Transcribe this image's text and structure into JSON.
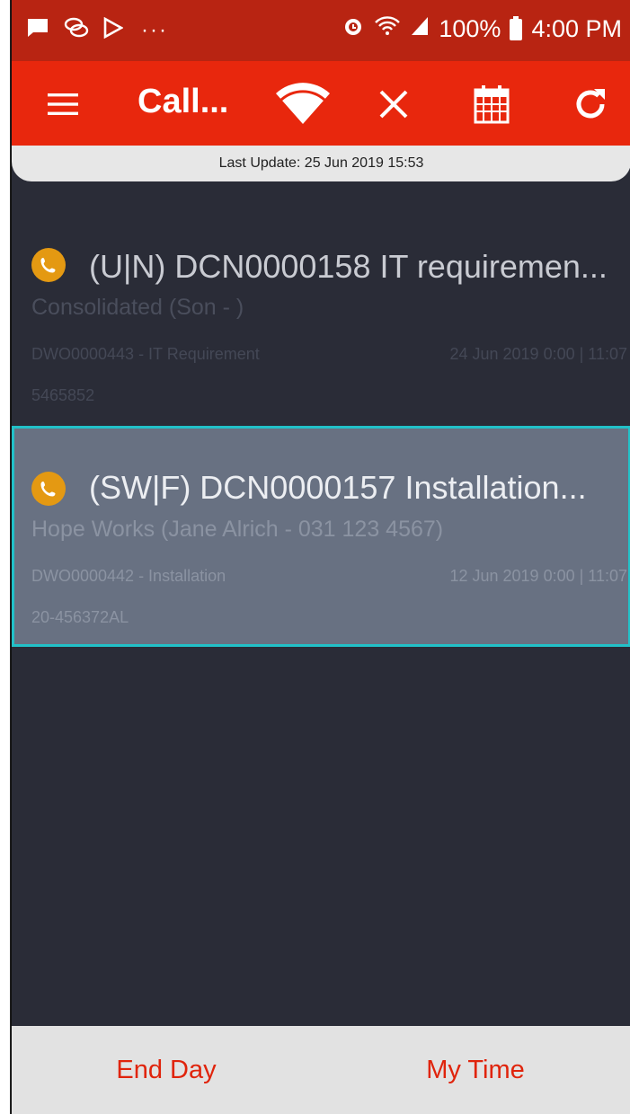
{
  "status_bar": {
    "battery": "100%",
    "time": "4:00 PM",
    "dots": "···",
    "icons": [
      "message-icon",
      "chat-bubbles-icon",
      "play-store-icon",
      "alarm-icon",
      "wifi-icon",
      "signal-icon",
      "battery-icon"
    ]
  },
  "app_bar": {
    "title": "Call...",
    "icons": [
      "menu-icon",
      "wifi-signal-icon",
      "close-icon",
      "calendar-icon",
      "refresh-icon"
    ]
  },
  "update": {
    "text": "Last Update: 25 Jun 2019 15:53"
  },
  "jobs": [
    {
      "title": "(U|N) DCN0000158 IT requiremen...",
      "customer": "Consolidated (Son  - )",
      "reference": "DWO0000443 - IT Requirement",
      "datetime": "24 Jun 2019 0:00 | 11:07",
      "number": "5465852",
      "selected": false
    },
    {
      "title": "(SW|F) DCN0000157 Installation...",
      "customer": "Hope Works (Jane Alrich - 031 123 4567)",
      "reference": "DWO0000442 - Installation",
      "datetime": "12 Jun 2019 0:00 | 11:07",
      "number": "20-456372AL",
      "selected": true
    }
  ],
  "bottom_bar": {
    "end_day": "End Day",
    "my_time": "My Time"
  },
  "colors": {
    "status_bar": "#b82412",
    "app_bar": "#e8270d",
    "list_bg": "#2a2c37",
    "selected_bg": "#687182",
    "selected_border": "#22c1c8",
    "phone_badge": "#e49912",
    "bottom_text": "#e0240c"
  }
}
